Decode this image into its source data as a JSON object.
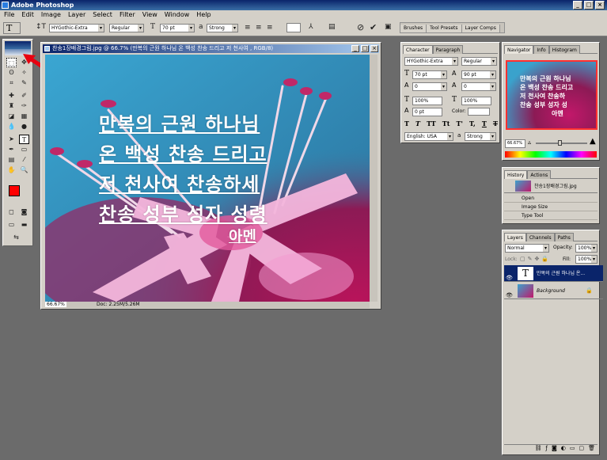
{
  "app": {
    "title": "Adobe Photoshop",
    "window_buttons": [
      "_",
      "□",
      "×"
    ]
  },
  "menu": [
    "File",
    "Edit",
    "Image",
    "Layer",
    "Select",
    "Filter",
    "View",
    "Window",
    "Help"
  ],
  "options": {
    "tool_glyph": "T",
    "font_family": "HYGothic-Extra",
    "font_style": "Regular",
    "size_glyph": "T",
    "font_size": "70 pt",
    "aa_glyph": "a",
    "antialias": "Strong"
  },
  "palette_well": [
    "Brushes",
    "Tool Presets",
    "Layer Comps"
  ],
  "document": {
    "title": "찬송1장배경그림.jpg @ 66.7% (만복의 근원 하나님  온 백성 찬송 드리고 저 천사여 , RGB/8)",
    "zoom": "66.67%",
    "doc_size": "Doc: 2.25M/5.26M",
    "lyrics": [
      "만복의 근원 하나님",
      "온 백성 찬송 드리고",
      "저 천사여 찬송하세",
      "찬송 성부 성자 성령",
      "아멘"
    ]
  },
  "character": {
    "tabs": [
      "Character",
      "Paragraph"
    ],
    "font_family": "HYGothic-Extra",
    "font_style": "Regular",
    "font_size": "70 pt",
    "leading": "90 pt",
    "kerning": "0",
    "tracking": "0",
    "vscale": "100%",
    "hscale": "100%",
    "baseline": "0 pt",
    "color_label": "Color:",
    "style_buttons": [
      "T",
      "T",
      "TT",
      "Tt",
      "T'",
      "T,",
      "T",
      "T"
    ],
    "language": "English: USA",
    "aa_glyph": "a",
    "antialias": "Strong"
  },
  "navigator": {
    "tabs": [
      "Navigator",
      "Info",
      "Histogram"
    ],
    "zoom": "66.67%",
    "lyrics": [
      "만복의 근원 하나님",
      "온 백성 찬송 드리고",
      "저 천사여 찬송하",
      "찬송 성부 성자 성",
      "아멘"
    ]
  },
  "history": {
    "tabs": [
      "History",
      "Actions"
    ],
    "snapshot": "찬송1장배경그림.jpg",
    "items": [
      "Open",
      "Image Size",
      "Type Tool"
    ]
  },
  "layers": {
    "tabs": [
      "Layers",
      "Channels",
      "Paths"
    ],
    "blend": "Normal",
    "opacity_label": "Opacity:",
    "opacity": "100%",
    "lock_label": "Lock:",
    "fill_label": "Fill:",
    "fill": "100%",
    "text_layer": "만복의 근원 하나님 온...",
    "text_thumb": "T",
    "background_layer": "Background"
  },
  "colors": {
    "accent": "#0a246a",
    "foreground": "#ff0000",
    "annotation": "#e8000f"
  }
}
